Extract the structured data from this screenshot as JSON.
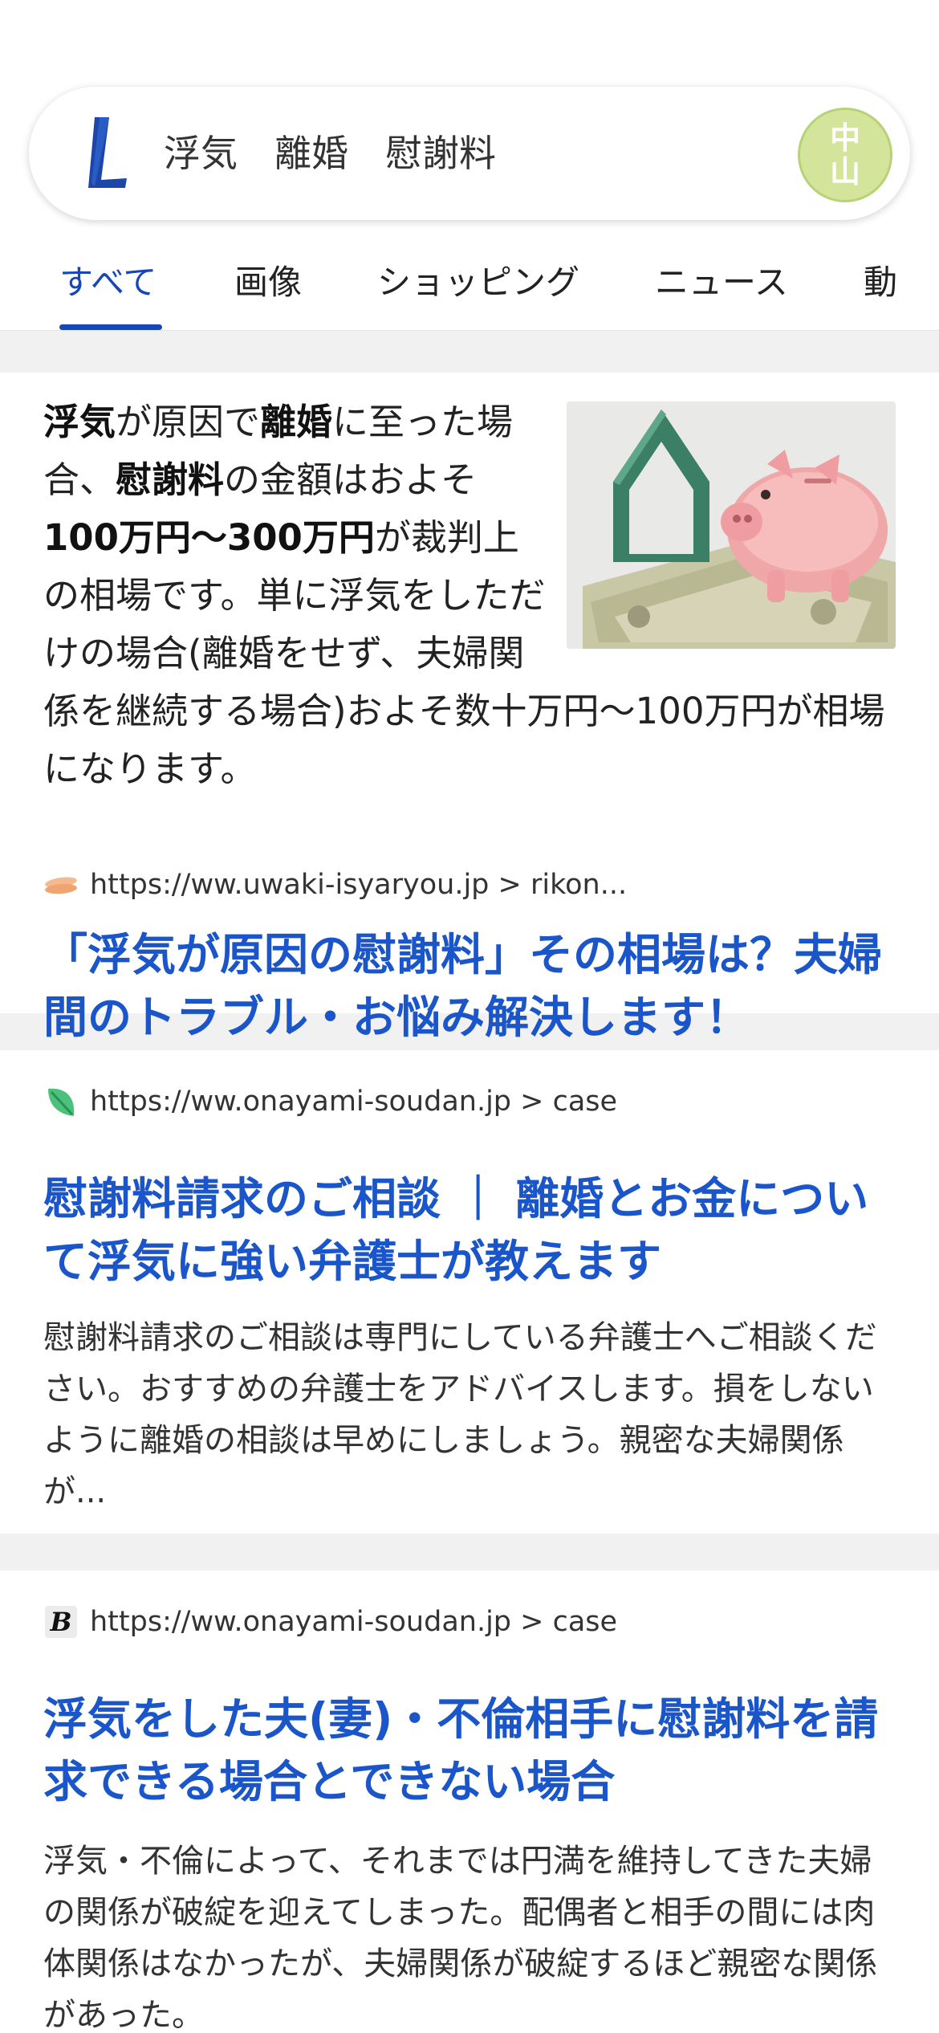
{
  "search": {
    "query": "浮気　離婚　慰謝料",
    "avatar_text": "中山"
  },
  "tabs": [
    "すべて",
    "画像",
    "ショッピング",
    "ニュース",
    "動"
  ],
  "featured": {
    "snippet_parts": [
      {
        "text": "浮気",
        "bold": true
      },
      {
        "text": "が原因で",
        "bold": false
      },
      {
        "text": "離婚",
        "bold": true
      },
      {
        "text": "に至った場合、",
        "bold": false
      },
      {
        "text": "慰謝料",
        "bold": true
      },
      {
        "text": "の金額はおよそ",
        "bold": false
      },
      {
        "text": "100万円〜300万円",
        "bold": true
      },
      {
        "text": "が裁判上の相場です。単に浮気をしただけの場合(離婚をせず、夫婦関係を継続する場合)およそ数十万円〜100万円が相場になります。",
        "bold": false
      }
    ],
    "image_icon": "piggy-bank-house-money-image",
    "url": "https://ww.uwaki-isyaryou.jp > rikon...",
    "title": "「浮気が原因の慰謝料」その相場は？夫婦間のトラブル・お悩み解決します！"
  },
  "results": [
    {
      "icon": "leaf-icon",
      "url": "https://ww.onayami-soudan.jp > case",
      "title": "慰謝料請求のご相談 ｜ 離婚とお金について浮気に強い弁護士が教えます",
      "description": "慰謝料請求のご相談は専門にしている弁護士へご相談ください。おすすめの弁護士をアドバイスします。損をしないように離婚の相談は早めにしましょう。親密な夫婦関係が..."
    },
    {
      "icon": "b-logo-icon",
      "icon_letter": "B",
      "url": "https://ww.onayami-soudan.jp > case",
      "title": "浮気をした夫(妻)・不倫相手に慰謝料を請求できる場合とできない場合",
      "description": "浮気・不倫によって、それまでは円満を維持してきた夫婦の関係が破綻を迎えてしまった。配偶者と相手の間には肉体関係はなかったが、夫婦関係が破綻するほど親密な関係があった。"
    }
  ],
  "colors": {
    "accent": "#1747b7",
    "link": "#1a56c9",
    "avatar_bg": "#d4e49a"
  }
}
